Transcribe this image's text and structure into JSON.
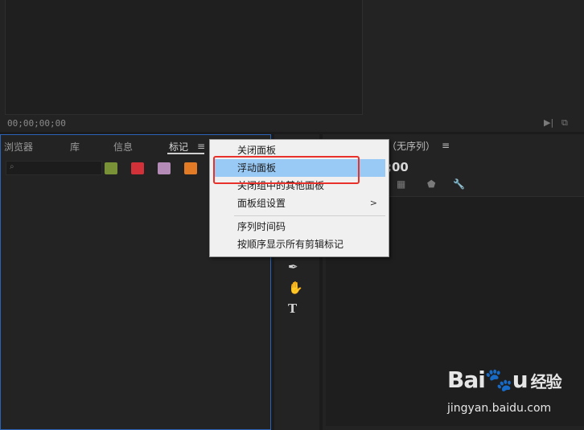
{
  "source_monitor": {
    "timecode": "00;00;00;00"
  },
  "left_panel": {
    "tabs": [
      "浏览器",
      "库",
      "信息",
      "标记"
    ],
    "active_tab": "标记",
    "menu_icon": "≡",
    "search_icon": "⌕",
    "swatches": [
      {
        "name": "olive",
        "color": "#7a9237"
      },
      {
        "name": "red",
        "color": "#d2313a"
      },
      {
        "name": "lavender",
        "color": "#b48ab7"
      },
      {
        "name": "orange",
        "color": "#e27a26"
      }
    ]
  },
  "program_monitor": {
    "title": "（无序列）",
    "menu_icon": "≡",
    "timecode": ";00",
    "controls": [
      "marker",
      "trim-in",
      "flag",
      "wrench"
    ]
  },
  "tools": [
    "pen-icon",
    "hand-icon",
    "type-icon"
  ],
  "context_menu": {
    "items": [
      {
        "label": "关闭面板",
        "highlighted": false,
        "submenu": false
      },
      {
        "label": "浮动面板",
        "highlighted": true,
        "submenu": false
      },
      {
        "label": "关闭组中的其他面板",
        "highlighted": false,
        "submenu": false
      },
      {
        "label": "面板组设置",
        "highlighted": false,
        "submenu": true
      },
      {
        "label": "序列时间码",
        "highlighted": false,
        "submenu": false
      },
      {
        "label": "按顺序显示所有剪辑标记",
        "highlighted": false,
        "submenu": false
      }
    ],
    "highlight_border_color": "#e8312a",
    "highlight_fill": "#99c9f5"
  },
  "watermark": {
    "logo": "Bai du 经验",
    "url": "jingyan.baidu.com"
  }
}
